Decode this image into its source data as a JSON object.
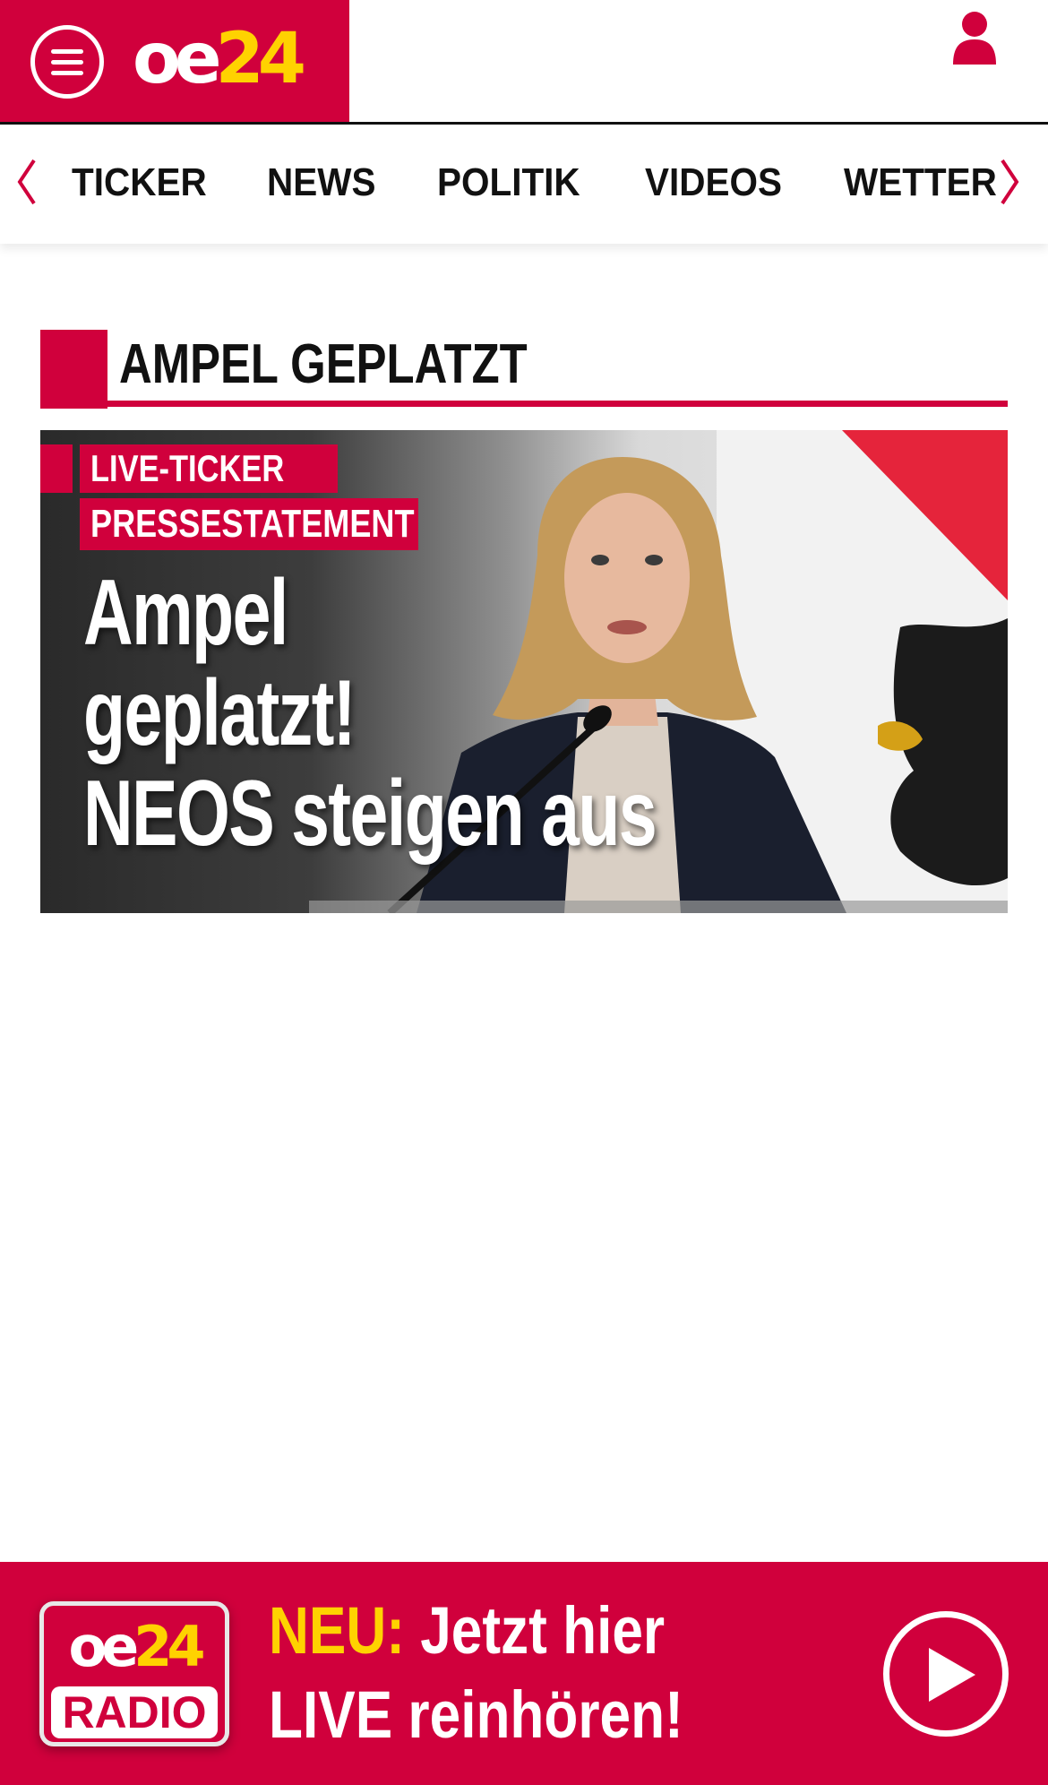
{
  "header": {
    "logo": {
      "oe": "oe",
      "num": "24"
    },
    "menu_icon": "hamburger-menu-icon",
    "user_icon": "user-icon"
  },
  "categories": {
    "prev_icon": "chevron-left-icon",
    "next_icon": "chevron-right-icon",
    "items": [
      "TICKER",
      "NEWS",
      "POLITIK",
      "VIDEOS",
      "WETTER"
    ]
  },
  "section": {
    "title": "AMPEL GEPLATZT"
  },
  "teaser": {
    "tags": [
      "LIVE-TICKER",
      "PRESSESTATEMENT"
    ],
    "headline_lines": [
      "Ampel",
      "geplatzt!",
      "NEOS steigen aus"
    ]
  },
  "radio_banner": {
    "logo_top": {
      "oe": "oe",
      "num": "24"
    },
    "logo_bottom": "RADIO",
    "highlight": "NEU:",
    "line1_rest": " Jetzt hier",
    "line2": "LIVE reinhören!",
    "play_icon": "play-icon"
  },
  "colors": {
    "brand_red": "#d0003c",
    "accent_yellow": "#ffd200",
    "text_dark": "#111111"
  }
}
